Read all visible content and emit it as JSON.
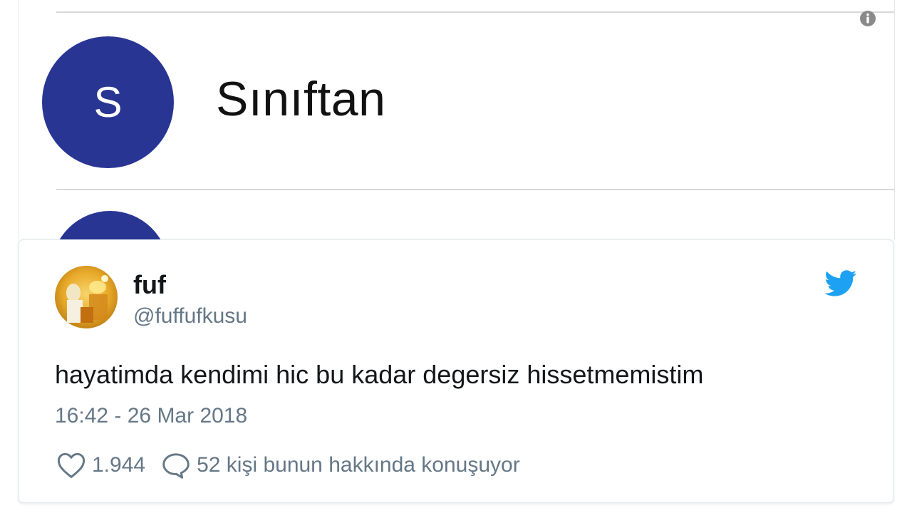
{
  "contact_list": {
    "avatar_letter": "S",
    "contact_name": "Sınıftan",
    "avatar_color": "#283593"
  },
  "tweet": {
    "display_name": "fuf",
    "handle": "@fuffufkusu",
    "text": "hayatimda kendimi hic bu kadar degersiz hissetmemistim",
    "timestamp": "16:42 - 26 Mar 2018",
    "like_count": "1.944",
    "reply_label": "52 kişi bunun hakkında konuşuyor",
    "brand_color": "#1da1f2"
  }
}
